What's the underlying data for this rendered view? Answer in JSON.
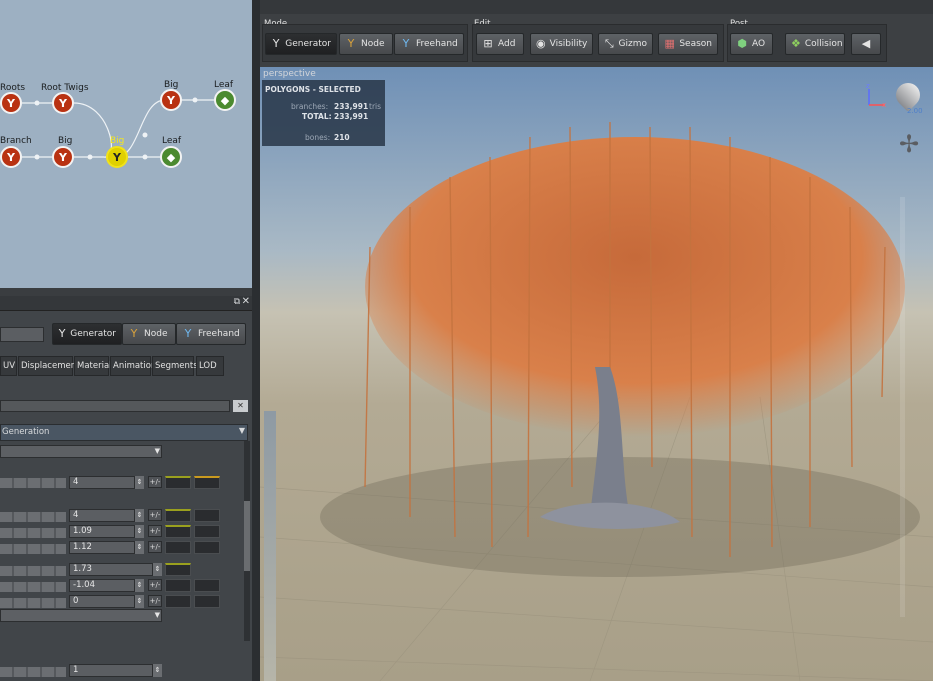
{
  "graph": {
    "nodes": [
      {
        "label": "Roots"
      },
      {
        "label": "Root Twigs"
      },
      {
        "label": "Big"
      },
      {
        "label": "Leaf"
      },
      {
        "label": "Branch"
      },
      {
        "label": "Big"
      },
      {
        "label": "Big"
      },
      {
        "label": "Leaf"
      }
    ]
  },
  "panel": {
    "mode_buttons": [
      "Generator",
      "Node",
      "Freehand"
    ],
    "tabs": [
      "UV",
      "Displacement",
      "Material",
      "Animation",
      "Segments",
      "LOD"
    ],
    "section": "Generation",
    "values": [
      "4",
      "4",
      "1.09",
      "1.12",
      "1.73",
      "-1.04",
      "0",
      "1"
    ],
    "pm": "+/-"
  },
  "toolbar": {
    "mode_label": "Mode",
    "edit_label": "Edit",
    "post_label": "Post",
    "mode": [
      "Generator",
      "Node",
      "Freehand"
    ],
    "edit": [
      "Add",
      "Visibility",
      "Gizmo",
      "Season"
    ],
    "post": [
      "AO",
      "Collision"
    ]
  },
  "viewport": {
    "camera": "perspective",
    "stats_title": "POLYGONS - SELECTED",
    "branches_label": "branches:",
    "branches_value": "233,991",
    "tris": "tris",
    "total_label": "TOTAL:",
    "total_value": "233,991",
    "bones_label": "bones:",
    "bones_value": "210",
    "axis_z": "z",
    "axis_x": "x",
    "light_value": "2.00"
  },
  "colors": {
    "graph_bg": "#9db0c2",
    "branch_node": "#b93212",
    "leaf_node": "#4b8a2f",
    "selected": "#f1e21a",
    "foliage": "#d9804a"
  }
}
